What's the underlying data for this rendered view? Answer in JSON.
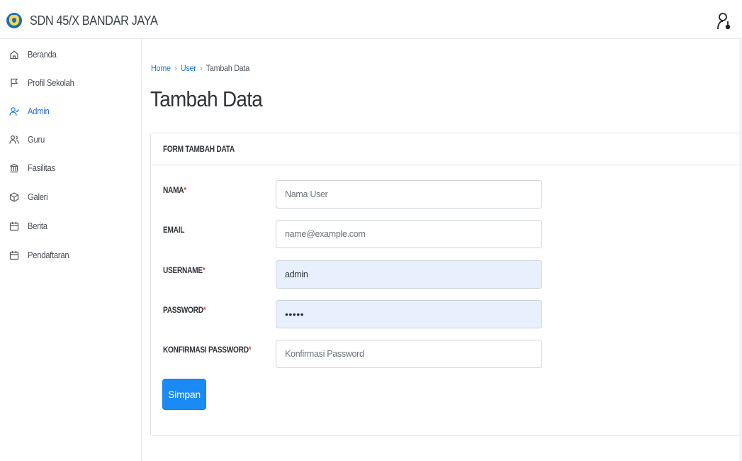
{
  "app": {
    "title": "SDN 45/X BANDAR JAYA",
    "logo": "school-emblem-icon",
    "user_icon": "user-icon"
  },
  "sidebar": {
    "items": [
      {
        "label": "Beranda",
        "icon": "home-icon",
        "active": false
      },
      {
        "label": "Profil Sekolah",
        "icon": "flag-icon",
        "active": false
      },
      {
        "label": "Admin",
        "icon": "user-check-icon",
        "active": true
      },
      {
        "label": "Guru",
        "icon": "users-icon",
        "active": false
      },
      {
        "label": "Fasilitas",
        "icon": "columns-icon",
        "active": false
      },
      {
        "label": "Galeri",
        "icon": "box-icon",
        "active": false
      },
      {
        "label": "Berita",
        "icon": "calendar-icon",
        "active": false
      },
      {
        "label": "Pendaftaran",
        "icon": "calendar-icon",
        "active": false
      }
    ]
  },
  "breadcrumb": {
    "home": "Home",
    "user": "User",
    "current": "Tambah Data",
    "separator": "›"
  },
  "page": {
    "title": "Tambah Data"
  },
  "form": {
    "title": "FORM TAMBAH DATA",
    "required_mark": "*",
    "fields": [
      {
        "label": "NAMA",
        "required": true,
        "placeholder": "Nama User",
        "value": ""
      },
      {
        "label": "EMAIL",
        "required": false,
        "placeholder": "name@example.com",
        "value": ""
      },
      {
        "label": "USERNAME",
        "required": true,
        "placeholder": "",
        "value": "admin"
      },
      {
        "label": "PASSWORD",
        "required": true,
        "placeholder": "",
        "value": "•••••"
      },
      {
        "label": "KONFIRMASI PASSWORD",
        "required": true,
        "placeholder": "Konfirmasi Password",
        "value": ""
      }
    ],
    "submit_label": "Simpan"
  },
  "colors": {
    "accent": "#1e73d8",
    "button": "#1b8af5",
    "required": "#e0403a",
    "autofill": "#e8f0fe"
  }
}
